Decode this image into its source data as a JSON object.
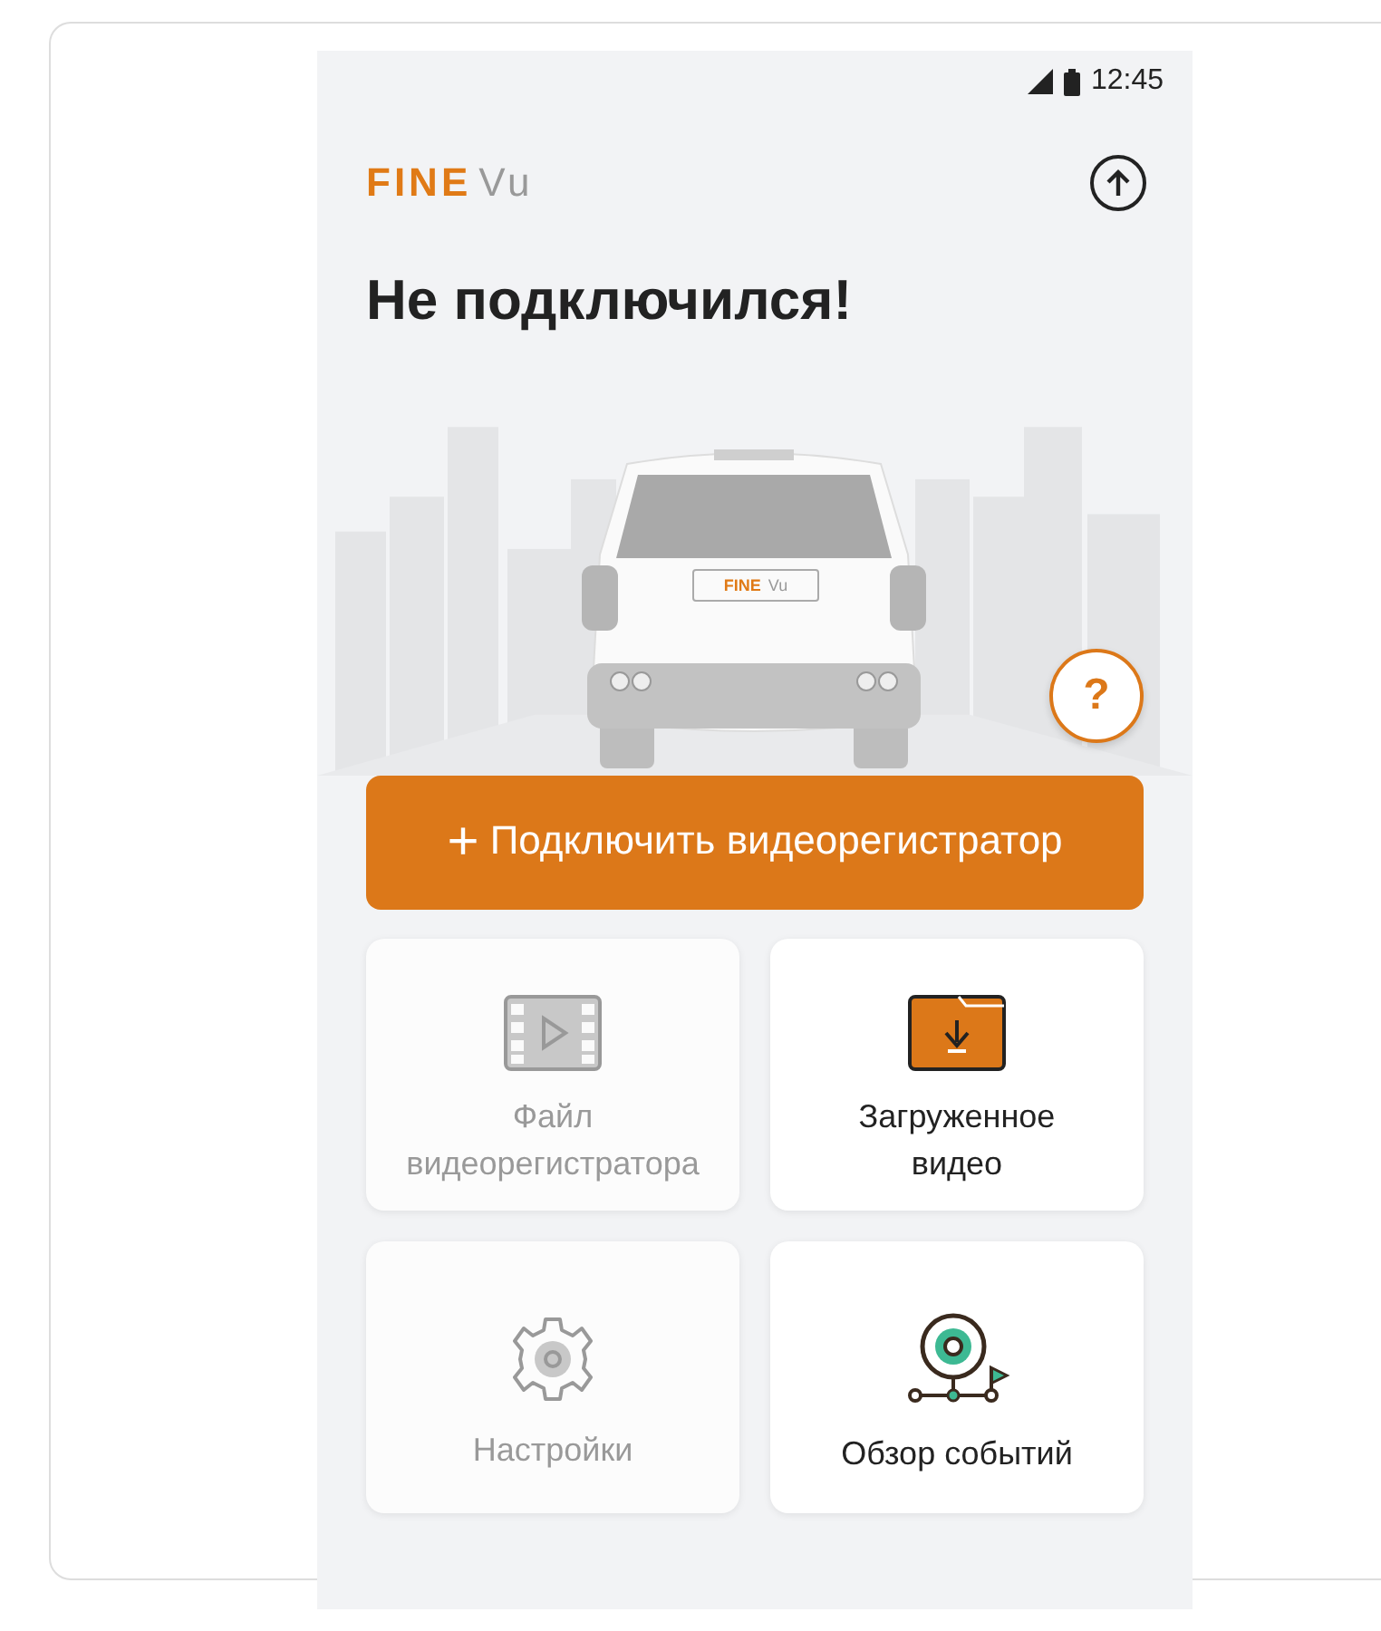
{
  "status_bar": {
    "time": "12:45"
  },
  "header": {
    "logo_primary": "FINE",
    "logo_secondary": "Vu"
  },
  "title": "Не подключился!",
  "illustration": {
    "plate_primary": "FINE",
    "plate_secondary": "Vu",
    "help_label": "?"
  },
  "connect_button": {
    "icon": "+",
    "label": "Подключить видеорегистратор"
  },
  "tiles": [
    {
      "kind": "film",
      "label_lines": [
        "Файл",
        "видеорегистратора"
      ],
      "disabled": true
    },
    {
      "kind": "folder",
      "label_lines": [
        "Загруженное",
        "видео"
      ],
      "disabled": false
    },
    {
      "kind": "gear",
      "label_lines": [
        "Настройки"
      ],
      "disabled": true
    },
    {
      "kind": "pin",
      "label_lines": [
        "Обзор событий"
      ],
      "disabled": false
    }
  ]
}
